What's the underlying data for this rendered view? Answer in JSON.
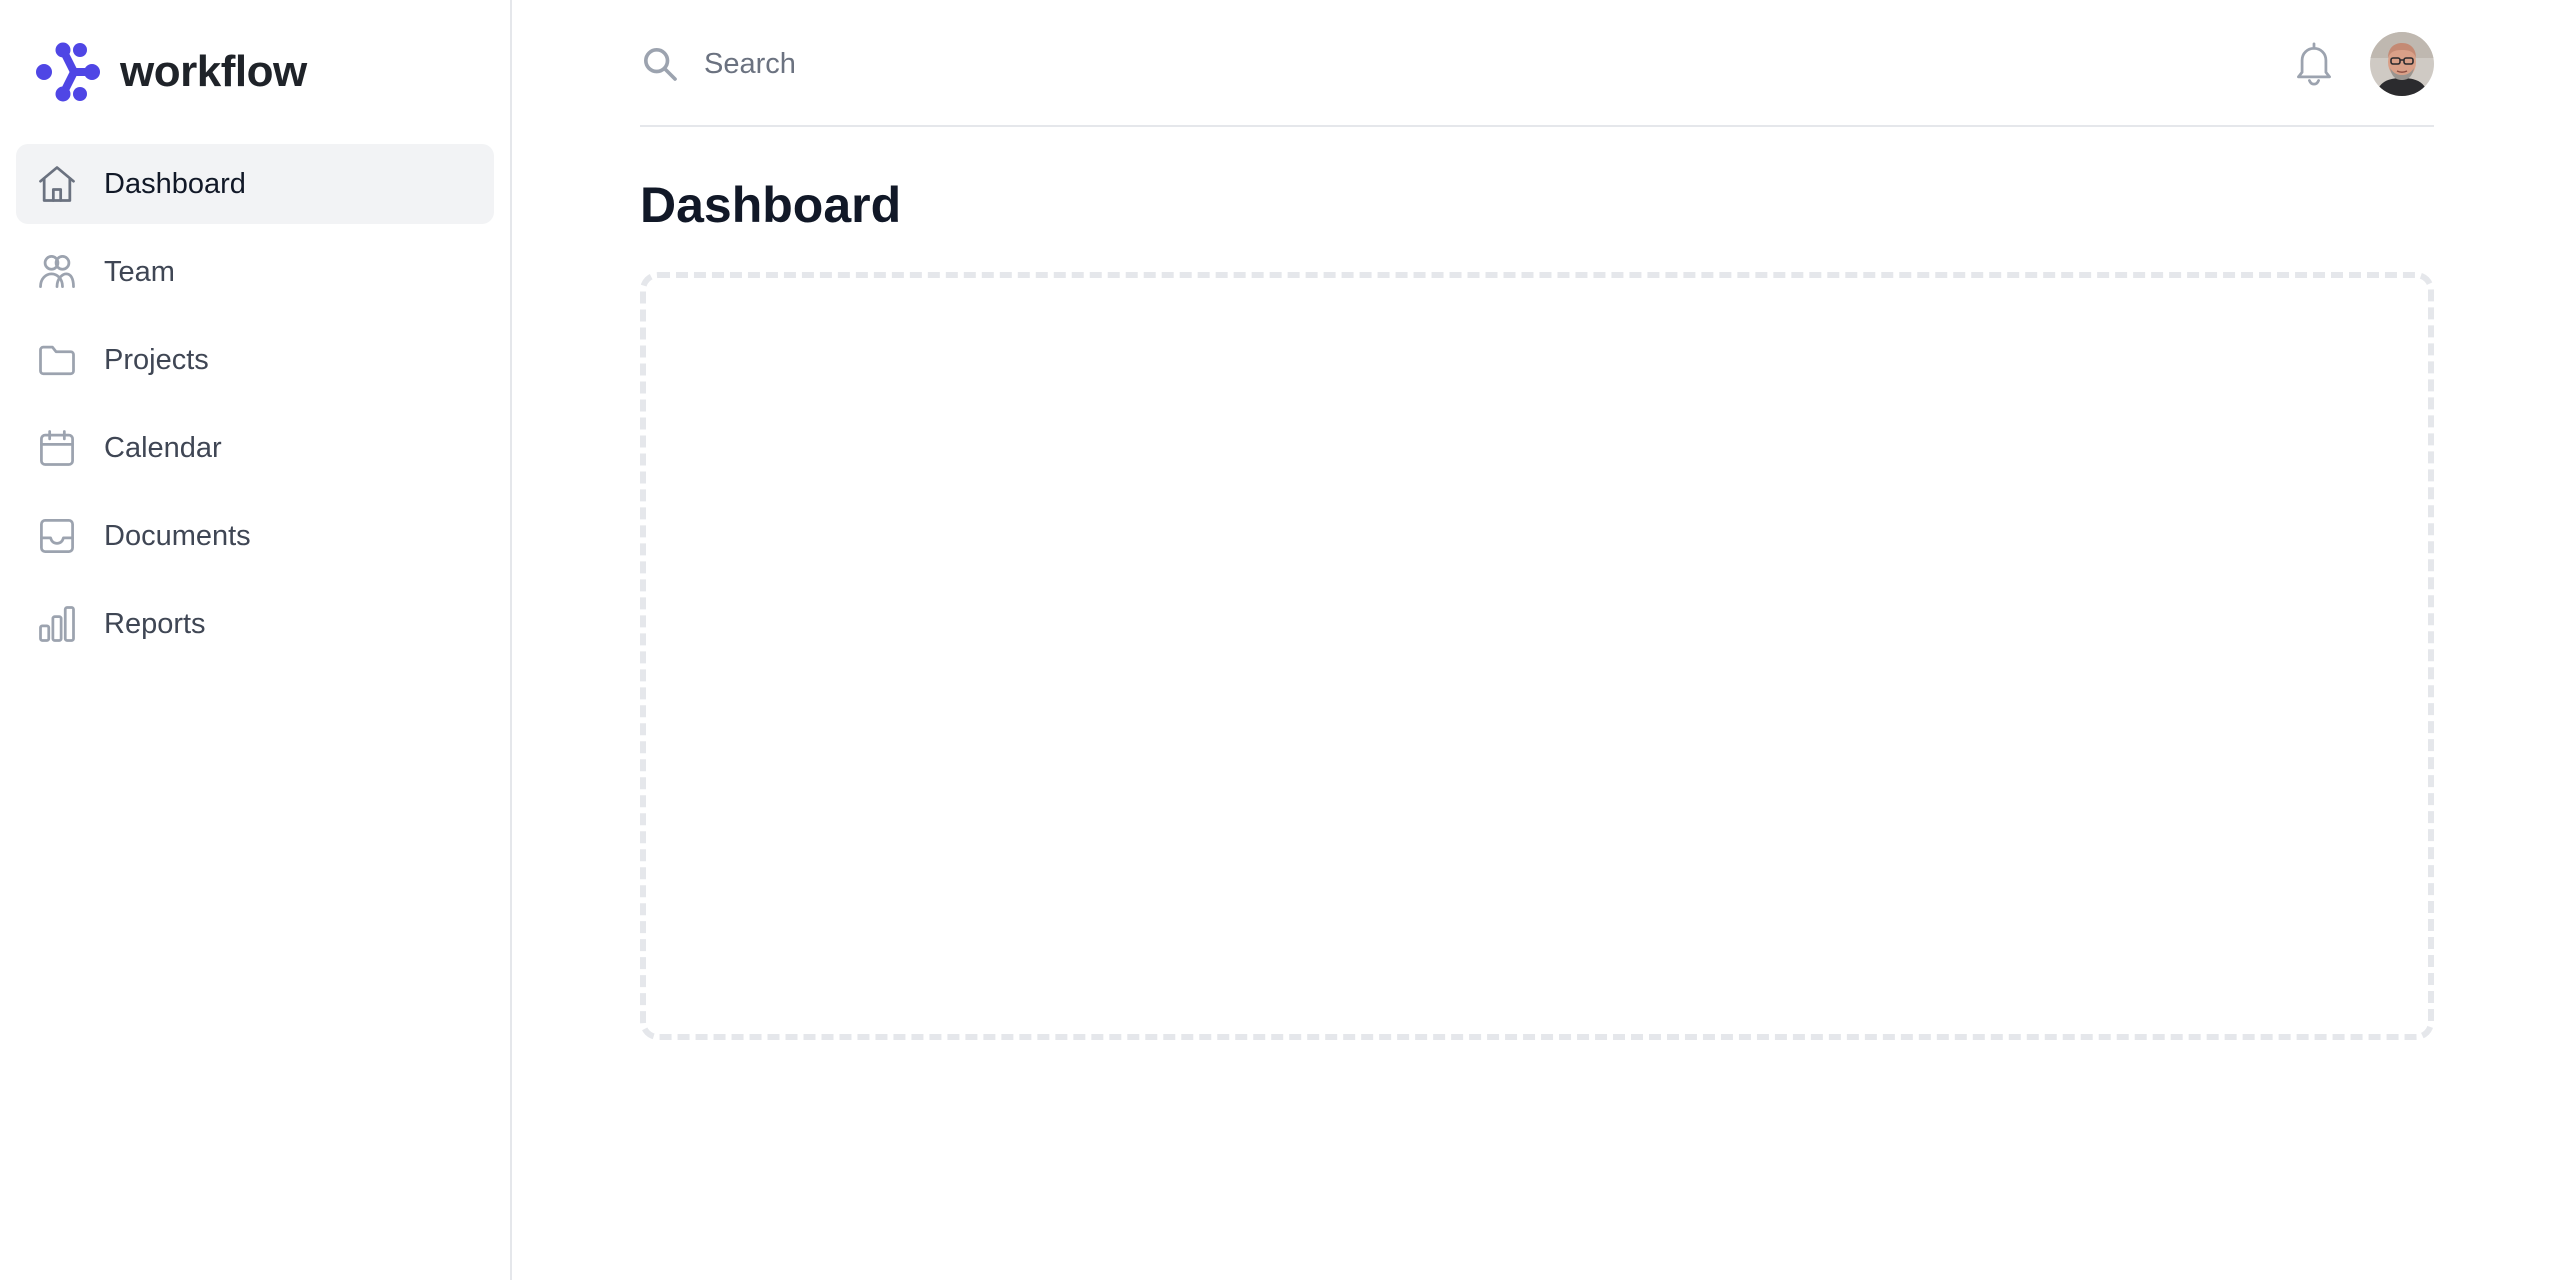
{
  "brand": {
    "name": "workflow",
    "logo_icon": "workflow-logo-icon",
    "accent_color": "#4f46e5"
  },
  "sidebar": {
    "items": [
      {
        "label": "Dashboard",
        "icon": "home-icon",
        "active": true
      },
      {
        "label": "Team",
        "icon": "users-icon",
        "active": false
      },
      {
        "label": "Projects",
        "icon": "folder-icon",
        "active": false
      },
      {
        "label": "Calendar",
        "icon": "calendar-icon",
        "active": false
      },
      {
        "label": "Documents",
        "icon": "inbox-icon",
        "active": false
      },
      {
        "label": "Reports",
        "icon": "bar-chart-icon",
        "active": false
      }
    ]
  },
  "header": {
    "search": {
      "placeholder": "Search",
      "value": ""
    },
    "notifications_icon": "bell-icon",
    "avatar_icon": "user-avatar"
  },
  "main": {
    "title": "Dashboard"
  }
}
